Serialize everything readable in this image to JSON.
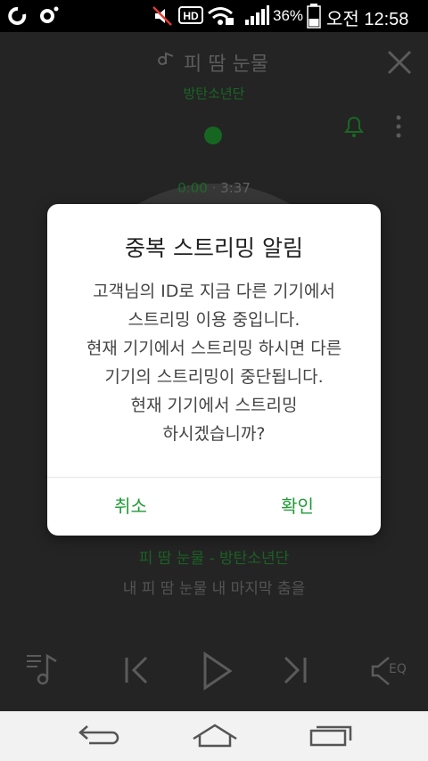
{
  "status_bar": {
    "battery": "36%",
    "time": "오전 12:58"
  },
  "player": {
    "song_title": "피 땀 눈물",
    "artist": "방탄소년단",
    "elapsed": "0:00",
    "separator": "·",
    "duration": "3:37",
    "now_playing_line": "피 땀 눈물 - 방탄소년단",
    "lyric_line": "내 피 땀 눈물 내 마지막 춤을",
    "eq_label": "EQ"
  },
  "dialog": {
    "title": "중복 스트리밍 알림",
    "message_lines": [
      "고객님의 ID로 지금 다른 기기에서",
      "스트리밍 이용 중입니다.",
      "현재 기기에서 스트리밍 하시면 다른",
      "기기의 스트리밍이 중단됩니다.",
      "현재 기기에서 스트리밍",
      "하시겠습니까?"
    ],
    "cancel_label": "취소",
    "confirm_label": "확인"
  },
  "colors": {
    "accent": "#1e9b34",
    "background": "#2d2d2d",
    "dialog_bg": "#ffffff"
  }
}
